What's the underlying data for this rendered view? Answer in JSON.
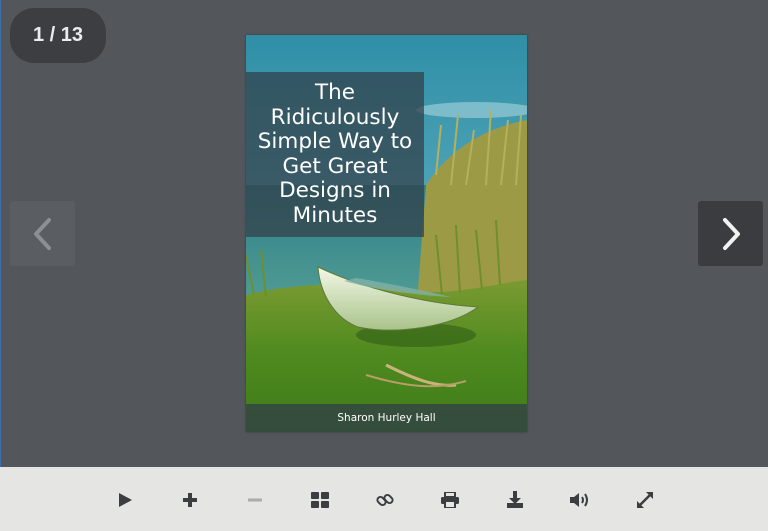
{
  "viewer": {
    "page_counter": "1 / 13",
    "prev_icon": "chevron-left-icon",
    "next_icon": "chevron-right-icon"
  },
  "book": {
    "title": "The Ridiculously Simple Way to Get Great Designs in Minutes",
    "author": "Sharon Hurley Hall"
  },
  "toolbar": {
    "items": [
      {
        "icon": "play-icon"
      },
      {
        "icon": "zoom-in-icon"
      },
      {
        "icon": "zoom-out-icon"
      },
      {
        "icon": "thumbnails-icon"
      },
      {
        "icon": "share-link-icon"
      },
      {
        "icon": "print-icon"
      },
      {
        "icon": "download-icon"
      },
      {
        "icon": "sound-icon"
      },
      {
        "icon": "fullscreen-icon"
      }
    ]
  },
  "colors": {
    "viewer_bg": "#53565a",
    "toolbar_bg": "#e5e6e4",
    "icon": "#3b3d40",
    "icon_disabled": "#a9abad"
  }
}
